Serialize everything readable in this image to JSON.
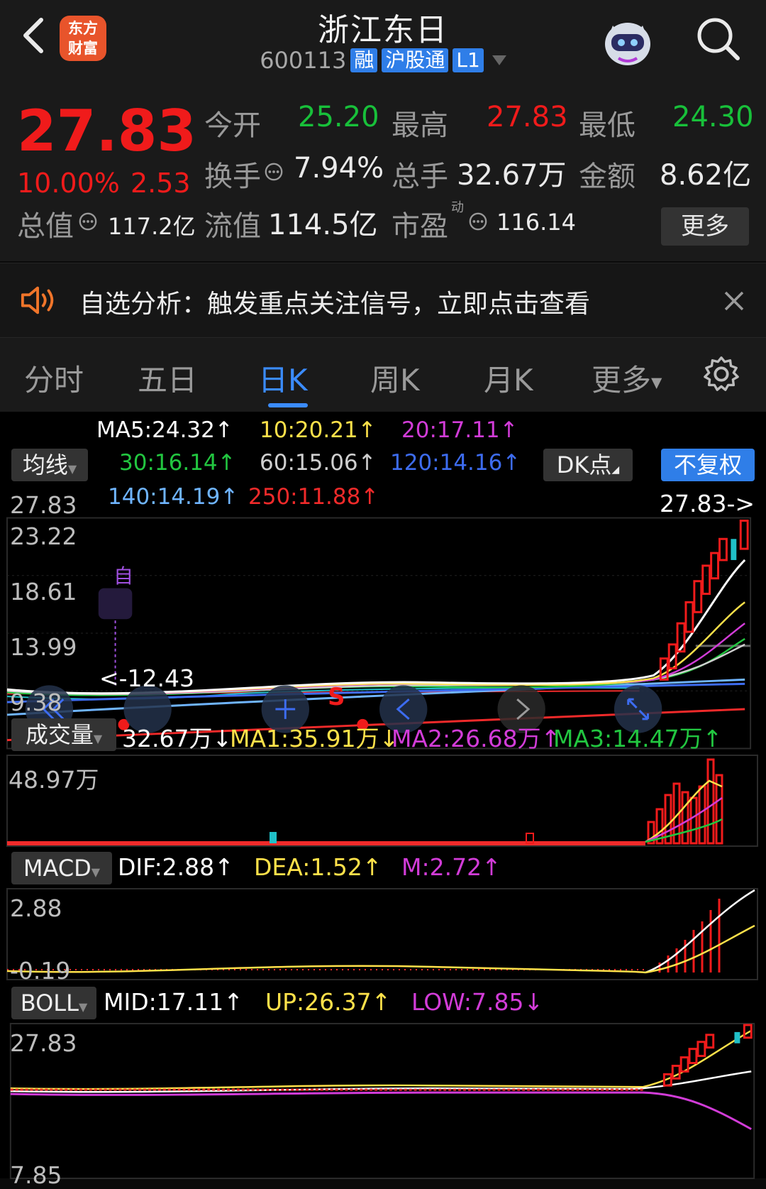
{
  "header": {
    "stock_name": "浙江东日",
    "stock_code": "600113",
    "tags": [
      "融",
      "沪股通",
      "L1"
    ],
    "logo_line1": "东方",
    "logo_line2": "财富"
  },
  "quote": {
    "price": "27.83",
    "change_pct": "10.00%",
    "change": "2.53",
    "open_label": "今开",
    "open": "25.20",
    "high_label": "最高",
    "high": "27.83",
    "low_label": "最低",
    "low": "24.30",
    "turnover_label": "换手",
    "turnover": "7.94%",
    "volume_label": "总手",
    "volume": "32.67万",
    "amount_label": "金额",
    "amount": "8.62亿",
    "total_value_label": "总值",
    "total_value": "117.2亿",
    "float_value_label": "流值",
    "float_value": "114.5亿",
    "pe_label": "市盈",
    "pe_sup": "动",
    "pe": "116.14",
    "more_label": "更多"
  },
  "alert": {
    "text": "自选分析：触发重点关注信号，立即点击查看"
  },
  "tabs": [
    "分时",
    "五日",
    "日K",
    "周K",
    "月K",
    "更多"
  ],
  "active_tab": "日K",
  "kline": {
    "ma_selector": "均线",
    "dk_label": "DK点",
    "adjust_label": "不复权",
    "ma": [
      {
        "text": "MA5:24.32↑",
        "color": "#ffffff"
      },
      {
        "text": "10:20.21↑",
        "color": "#ffe14a"
      },
      {
        "text": "20:17.11↑",
        "color": "#d23cd8"
      },
      {
        "text": "30:16.14↑",
        "color": "#22c640"
      },
      {
        "text": "60:15.06↑",
        "color": "#cfcfcf"
      },
      {
        "text": "120:14.16↑",
        "color": "#3d6cf0"
      },
      {
        "text": "140:14.19↑",
        "color": "#6fb4ff"
      },
      {
        "text": "250:11.88↑",
        "color": "#f02a2a"
      }
    ],
    "price_axis": [
      "27.83",
      "23.22",
      "18.61",
      "13.99",
      "9.38"
    ],
    "last_price_label": "27.83->",
    "low_price_label": "<-12.43",
    "marker_self": "自",
    "marker_sell": "S"
  },
  "volume": {
    "selector": "成交量",
    "value": "32.67万↓",
    "ma1": "MA1:35.91万↓",
    "ma2": "MA2:26.68万↑",
    "ma3": "MA3:14.47万↑",
    "axis_top": "48.97万"
  },
  "macd": {
    "selector": "MACD",
    "dif": "DIF:2.88↑",
    "dea": "DEA:1.52↑",
    "m": "M:2.72↑",
    "axis_top": "2.88",
    "axis_bottom": "-0.19"
  },
  "boll": {
    "selector": "BOLL",
    "mid": "MID:17.11↑",
    "up": "UP:26.37↑",
    "low": "LOW:7.85↓",
    "axis_top": "27.83",
    "axis_bottom": "7.85"
  },
  "colors": {
    "up": "#f01b1b",
    "down": "#18c03a",
    "accent": "#3b8cff"
  },
  "icons": [
    "back-icon",
    "search-icon",
    "robot-icon",
    "speaker-icon",
    "close-icon",
    "gear-icon",
    "info-icon"
  ]
}
